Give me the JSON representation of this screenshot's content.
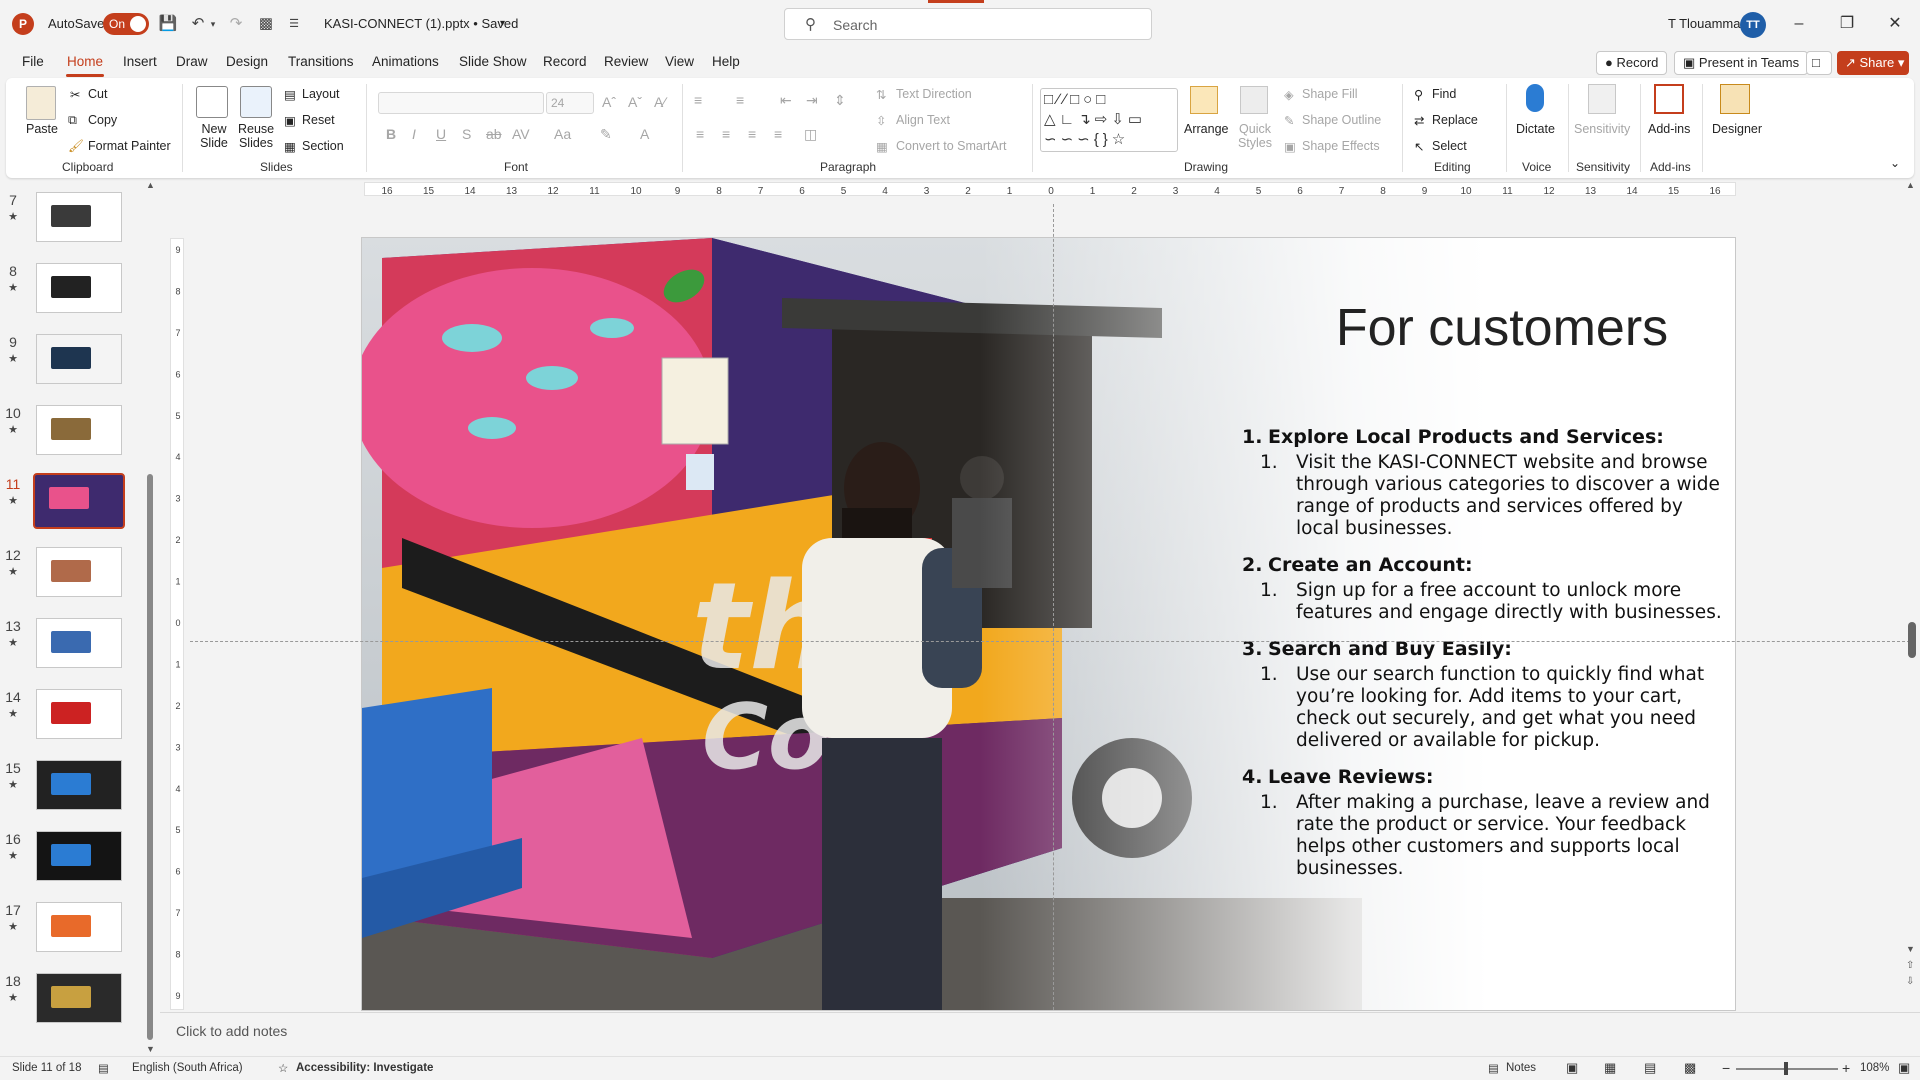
{
  "app": {
    "logo": "P",
    "autosave_label": "AutoSave",
    "autosave_state": "On",
    "doc_title": "KASI-CONNECT (1).pptx • Saved",
    "user_name": "T Tlouamma",
    "user_initials": "TT",
    "accent": "#c43e1c"
  },
  "search": {
    "placeholder": "Search"
  },
  "tabs": [
    "File",
    "Home",
    "Insert",
    "Draw",
    "Design",
    "Transitions",
    "Animations",
    "Slide Show",
    "Record",
    "Review",
    "View",
    "Help"
  ],
  "header_buttons": {
    "record": "Record",
    "present": "Present in Teams",
    "share": "Share"
  },
  "ribbon": {
    "clipboard": {
      "paste": "Paste",
      "cut": "Cut",
      "copy": "Copy",
      "format_painter": "Format Painter",
      "label": "Clipboard"
    },
    "slides": {
      "new_slide": "New Slide",
      "reuse": "Reuse Slides",
      "layout": "Layout",
      "reset": "Reset",
      "section": "Section",
      "label": "Slides"
    },
    "font": {
      "size": "24",
      "label": "Font"
    },
    "paragraph": {
      "text_direction": "Text Direction",
      "align_text": "Align Text",
      "smartart": "Convert to SmartArt",
      "label": "Paragraph"
    },
    "drawing": {
      "arrange": "Arrange",
      "quick_styles": "Quick Styles",
      "shape_fill": "Shape Fill",
      "shape_outline": "Shape Outline",
      "shape_effects": "Shape Effects",
      "label": "Drawing"
    },
    "editing": {
      "find": "Find",
      "replace": "Replace",
      "select": "Select",
      "label": "Editing"
    },
    "voice": {
      "dictate": "Dictate",
      "label": "Voice"
    },
    "sensitivity": {
      "btn": "Sensitivity",
      "label": "Sensitivity"
    },
    "addins": {
      "btn": "Add-ins",
      "label": "Add-ins"
    },
    "designer": {
      "btn": "Designer"
    }
  },
  "thumbnails": [
    {
      "num": "7",
      "star": "★"
    },
    {
      "num": "8",
      "star": "★"
    },
    {
      "num": "9",
      "star": "★"
    },
    {
      "num": "10",
      "star": "★"
    },
    {
      "num": "11",
      "star": "★"
    },
    {
      "num": "12",
      "star": "★"
    },
    {
      "num": "13",
      "star": "★"
    },
    {
      "num": "14",
      "star": "★"
    },
    {
      "num": "15",
      "star": "★"
    },
    {
      "num": "16",
      "star": "★"
    },
    {
      "num": "17",
      "star": "★"
    },
    {
      "num": "18",
      "star": "★"
    }
  ],
  "slide": {
    "title": "For customers",
    "items": [
      {
        "num": "1.",
        "head": "Explore Local Products and Services:",
        "sub_num": "1.",
        "sub": "Visit the KASI-CONNECT website and browse through various categories to discover a wide range of products and services offered by local businesses."
      },
      {
        "num": "2.",
        "head": "Create an Account:",
        "sub_num": "1.",
        "sub": "Sign up for a free account to unlock more features and engage directly with businesses."
      },
      {
        "num": "3.",
        "head": "Search and Buy Easily:",
        "sub_num": "1.",
        "sub": "Use our search function to quickly find what you’re looking for. Add items to your cart, check out securely, and get what you need delivered or available for pickup."
      },
      {
        "num": "4.",
        "head": "Leave Reviews:",
        "sub_num": "1.",
        "sub": "After making a purchase, leave a review and rate the product or service. Your feedback helps other customers and supports local businesses."
      }
    ]
  },
  "notes": {
    "placeholder": "Click to add notes"
  },
  "status": {
    "slide_of": "Slide 11 of 18",
    "language": "English (South Africa)",
    "accessibility": "Accessibility: Investigate",
    "notes": "Notes",
    "zoom": "108%"
  },
  "hruler_ticks": [
    "16",
    "15",
    "14",
    "13",
    "12",
    "11",
    "10",
    "9",
    "8",
    "7",
    "6",
    "5",
    "4",
    "3",
    "2",
    "1",
    "0",
    "1",
    "2",
    "3",
    "4",
    "5",
    "6",
    "7",
    "8",
    "9",
    "10",
    "11",
    "12",
    "13",
    "14",
    "15",
    "16"
  ],
  "vruler_ticks": [
    "9",
    "8",
    "7",
    "6",
    "5",
    "4",
    "3",
    "2",
    "1",
    "0",
    "1",
    "2",
    "3",
    "4",
    "5",
    "6",
    "7",
    "8",
    "9"
  ]
}
